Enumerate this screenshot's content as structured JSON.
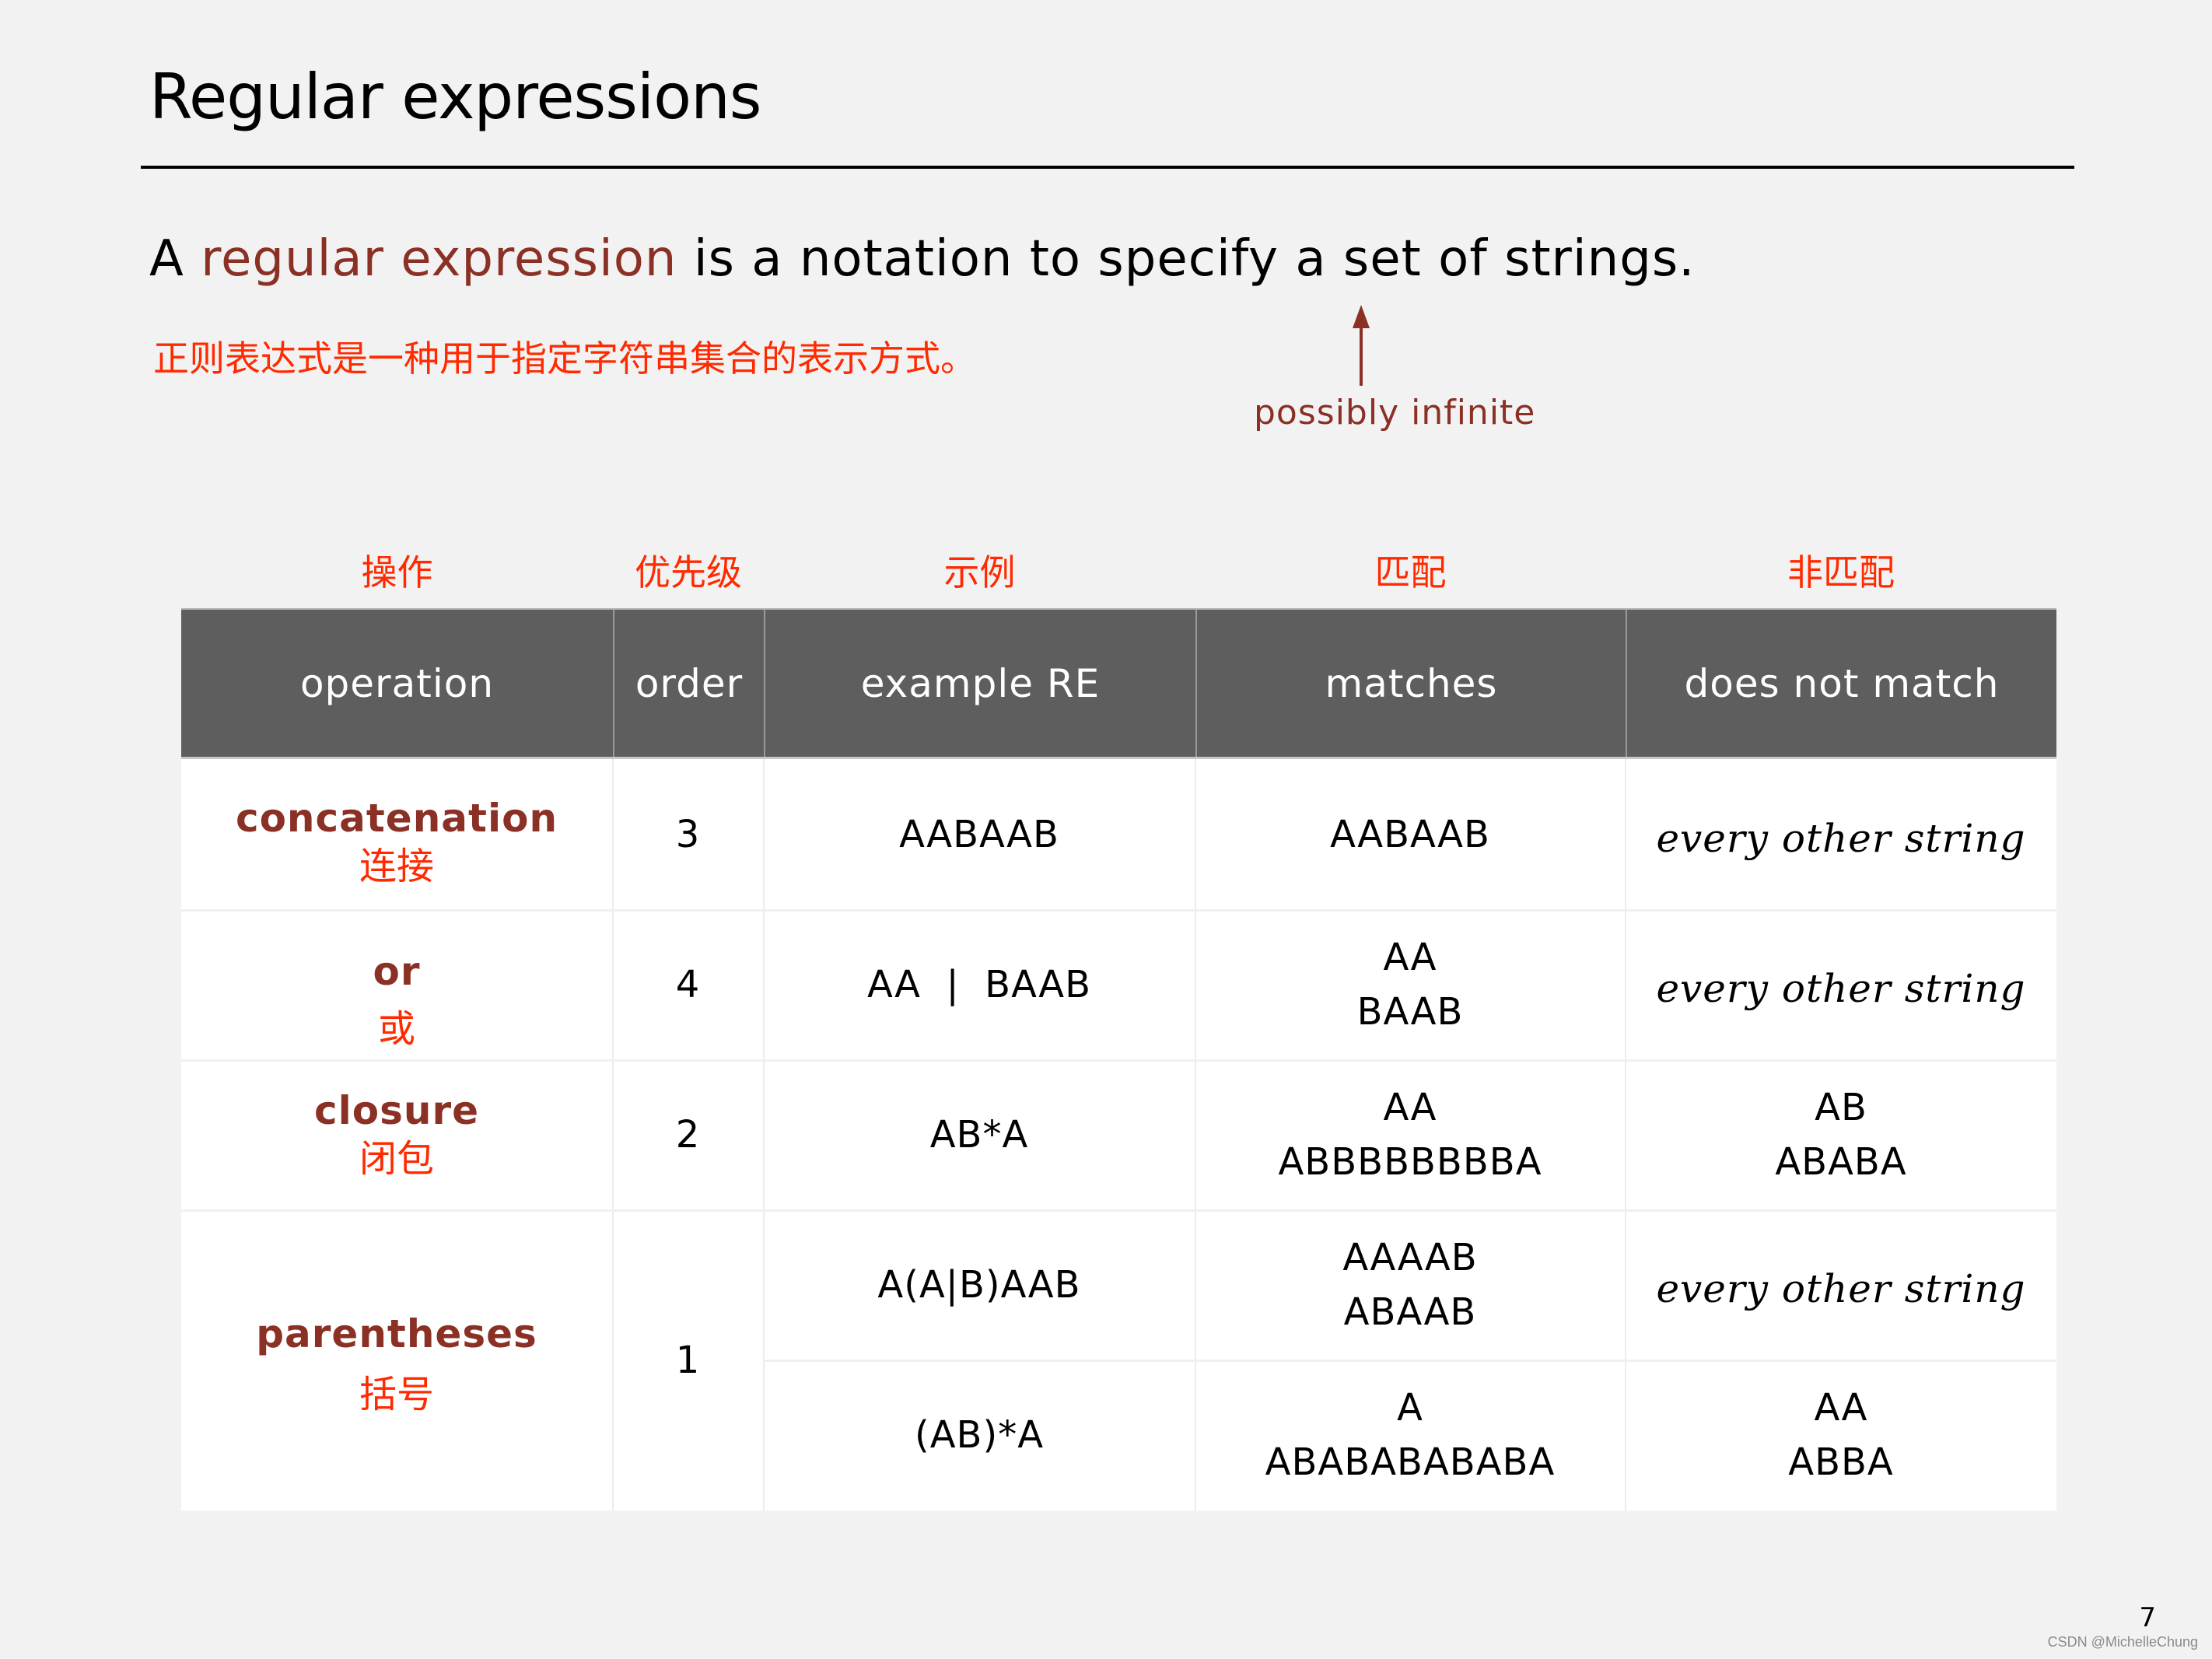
{
  "slide": {
    "title": "Regular expressions",
    "lead": {
      "prefix": "A ",
      "highlight": "regular expression",
      "suffix": " is a notation to specify a set of strings."
    },
    "chinese_translation": "正则表达式是一种用于指定字符串集合的表示方式。",
    "annotation": "possibly infinite",
    "page_number": "7",
    "watermark": "CSDN @MichelleChung"
  },
  "colors": {
    "accent_brown": "#8b3025",
    "chinese_red": "#ff2a00",
    "header_gray": "#5e5e5e",
    "background": "#f2f2f2"
  },
  "table": {
    "chinese_headers": [
      "操作",
      "优先级",
      "示例",
      "匹配",
      "非匹配"
    ],
    "headers": [
      "operation",
      "order",
      "example RE",
      "matches",
      "does not match"
    ],
    "rows": [
      {
        "operation": "concatenation",
        "operation_cn": "连接",
        "order": "3",
        "examples": [
          {
            "re": "AABAAB",
            "matches": [
              "AABAAB"
            ],
            "does_not_match": [
              "every other string"
            ],
            "dnm_italic": true
          }
        ]
      },
      {
        "operation": "or",
        "operation_cn": "或",
        "order": "4",
        "examples": [
          {
            "re": "AA  |  BAAB",
            "matches": [
              "AA",
              "BAAB"
            ],
            "does_not_match": [
              "every other string"
            ],
            "dnm_italic": true
          }
        ]
      },
      {
        "operation": "closure",
        "operation_cn": "闭包",
        "order": "2",
        "examples": [
          {
            "re": "AB*A",
            "matches": [
              "AA",
              "ABBBBBBBBA"
            ],
            "does_not_match": [
              "AB",
              "ABABA"
            ],
            "dnm_italic": false
          }
        ]
      },
      {
        "operation": "parentheses",
        "operation_cn": "括号",
        "order": "1",
        "examples": [
          {
            "re": "A(A|B)AAB",
            "matches": [
              "AAAAB",
              "ABAAB"
            ],
            "does_not_match": [
              "every other string"
            ],
            "dnm_italic": true
          },
          {
            "re": "(AB)*A",
            "matches": [
              "A",
              "ABABABABABA"
            ],
            "does_not_match": [
              "AA",
              "ABBA"
            ],
            "dnm_italic": false
          }
        ]
      }
    ]
  }
}
